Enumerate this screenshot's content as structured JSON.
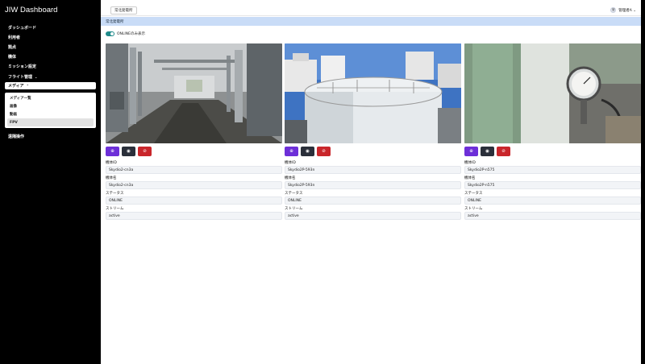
{
  "app": {
    "title": "JIW Dashboard"
  },
  "sidebar": {
    "items": [
      {
        "label": "ダッシュボード"
      },
      {
        "label": "利用者"
      },
      {
        "label": "拠点"
      },
      {
        "label": "機体"
      },
      {
        "label": "ミッション設定"
      },
      {
        "label": "フライト管理",
        "chevron": "⌄"
      },
      {
        "label": "メディア",
        "chevron": "⌃"
      }
    ],
    "submenu": [
      {
        "label": "メディア一覧"
      },
      {
        "label": "画像"
      },
      {
        "label": "動画"
      },
      {
        "label": "FPV"
      }
    ],
    "after": [
      {
        "label": "遠隔操作"
      }
    ]
  },
  "topbar": {
    "site_chip": "常北発電所",
    "user_avatar": "管",
    "user_label": "管理者A ⌄"
  },
  "banner": {
    "text": "常北発電所"
  },
  "filter": {
    "label": "ONLINEのみ表示",
    "enabled": true
  },
  "field_labels": {
    "machine_id": "機体ID",
    "machine_name": "機体名",
    "status": "ステータス",
    "stream": "ストリーム"
  },
  "feeds": [
    {
      "machine_id": "Skydio2-cn3a",
      "machine_name": "Skydio2-cn3a",
      "status": "ONLINE",
      "stream": "active"
    },
    {
      "machine_id": "Skydio2P-593n",
      "machine_name": "Skydio2P-593n",
      "status": "ONLINE",
      "stream": "active"
    },
    {
      "machine_id": "Skydio2P-n575",
      "machine_name": "Skydio2P-n575",
      "status": "ONLINE",
      "stream": "active"
    }
  ],
  "buttons": {
    "zoom": "⊕",
    "record": "◉",
    "disconnect": "⊘"
  },
  "colors": {
    "purple": "#6d2fd8",
    "dark": "#2a2f3a",
    "red": "#c9262b",
    "toggle": "#1f8a8a",
    "banner": "#c9dcf7"
  }
}
